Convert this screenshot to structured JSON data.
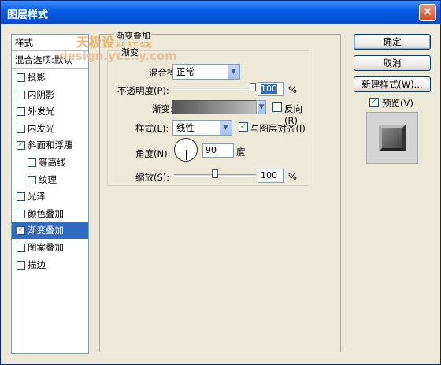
{
  "window": {
    "title": "图层样式",
    "close_glyph": "×"
  },
  "watermark": {
    "line1": "天极设计在线",
    "line2": "design.yesky.com"
  },
  "sidebar": {
    "header": "样式",
    "blend_options": "混合选项:默认",
    "items": [
      {
        "label": "投影",
        "checked": false,
        "indent": false
      },
      {
        "label": "内阴影",
        "checked": false,
        "indent": false
      },
      {
        "label": "外发光",
        "checked": false,
        "indent": false
      },
      {
        "label": "内发光",
        "checked": false,
        "indent": false
      },
      {
        "label": "斜面和浮雕",
        "checked": true,
        "indent": false
      },
      {
        "label": "等高线",
        "checked": false,
        "indent": true
      },
      {
        "label": "纹理",
        "checked": false,
        "indent": true
      },
      {
        "label": "光泽",
        "checked": false,
        "indent": false
      },
      {
        "label": "颜色叠加",
        "checked": false,
        "indent": false
      },
      {
        "label": "渐变叠加",
        "checked": true,
        "indent": false,
        "selected": true
      },
      {
        "label": "图案叠加",
        "checked": false,
        "indent": false
      },
      {
        "label": "描边",
        "checked": false,
        "indent": false
      }
    ]
  },
  "panel": {
    "outer_title": "渐变叠加",
    "inner_title": "渐变",
    "blend_mode": {
      "label": "混合模式:",
      "value": "正常"
    },
    "opacity": {
      "label": "不透明度(P):",
      "value": "100",
      "unit": "%",
      "level": 1.0
    },
    "gradient": {
      "label": "渐变:",
      "reverse_label": "反向(R)",
      "reverse_checked": false
    },
    "style": {
      "label": "样式(L):",
      "value": "线性",
      "align_label": "与图层对齐(I)",
      "align_checked": true
    },
    "angle": {
      "label": "角度(N):",
      "value": "90",
      "unit": "度",
      "degrees": 90
    },
    "scale": {
      "label": "缩放(S):",
      "value": "100",
      "unit": "%",
      "level": 0.5
    }
  },
  "buttons": {
    "ok": "确定",
    "cancel": "取消",
    "new_style": "新建样式(W)...",
    "preview_label": "预览(V)",
    "preview_checked": true
  },
  "check_glyph": "✓",
  "dropdown_glyph": "▼"
}
